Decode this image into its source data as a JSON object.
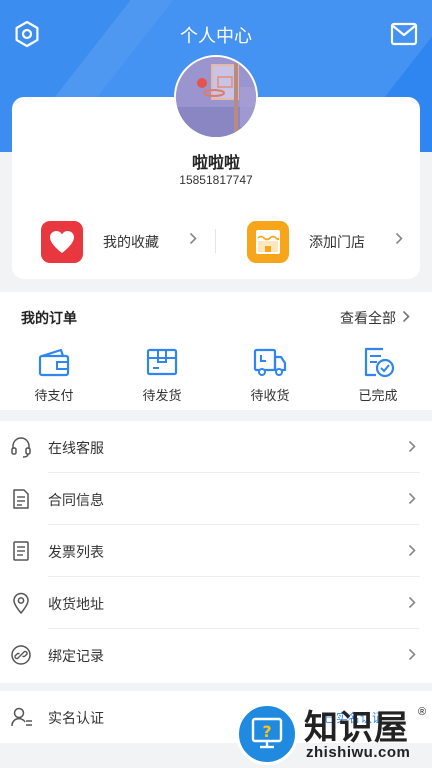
{
  "colors": {
    "brand": "#2f86f0",
    "heart_bg": "#e9373f",
    "store_bg": "#f7a61c",
    "link": "#3a86ee"
  },
  "header": {
    "title": "个人中心",
    "left_icon": "settings-hexagon-icon",
    "right_icon": "mail-icon"
  },
  "profile": {
    "name": "啦啦啦",
    "phone": "15851817747"
  },
  "quick_actions": [
    {
      "label": "我的收藏",
      "icon": "heart-icon"
    },
    {
      "label": "添加门店",
      "icon": "store-icon"
    }
  ],
  "orders": {
    "title": "我的订单",
    "view_all": "查看全部",
    "statuses": [
      {
        "label": "待支付",
        "icon": "wallet-icon"
      },
      {
        "label": "待发货",
        "icon": "package-icon"
      },
      {
        "label": "待收货",
        "icon": "delivery-truck-icon"
      },
      {
        "label": "已完成",
        "icon": "completed-doc-icon"
      }
    ]
  },
  "menu": [
    {
      "label": "在线客服",
      "icon": "headset-icon"
    },
    {
      "label": "合同信息",
      "icon": "contract-icon"
    },
    {
      "label": "发票列表",
      "icon": "invoice-icon"
    },
    {
      "label": "收货地址",
      "icon": "location-pin-icon"
    },
    {
      "label": "绑定记录",
      "icon": "link-icon"
    }
  ],
  "realname": {
    "label": "实名认证",
    "status": "已实名认证",
    "icon": "user-id-icon"
  },
  "watermark": {
    "brand": "知识屋",
    "reg_mark": "®",
    "url": "zhishiwu.com"
  }
}
